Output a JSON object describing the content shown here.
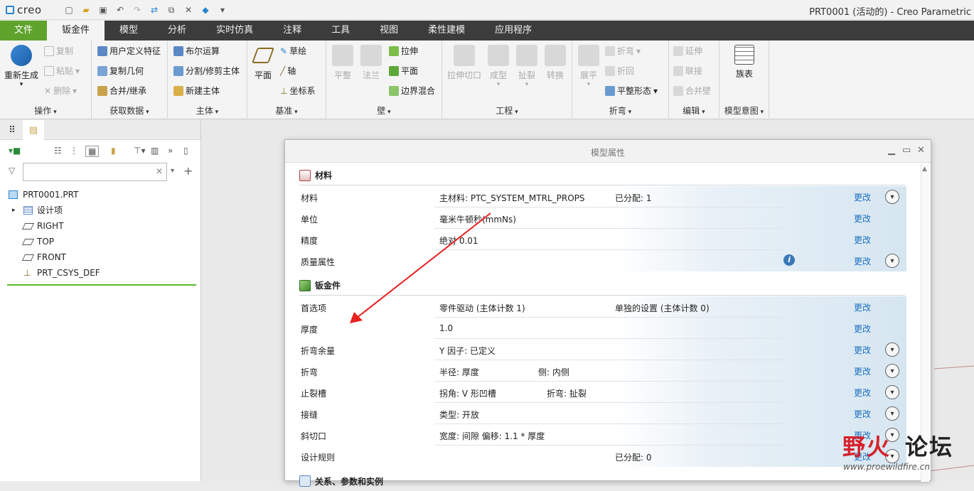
{
  "app": {
    "logo": "creo",
    "window_title": "PRT0001 (活动的) - Creo Parametric"
  },
  "quick_access": [
    "new-icon",
    "open-icon",
    "save-icon",
    "undo-icon",
    "redo-icon",
    "regenerate-icon",
    "windows-icon",
    "close-icon",
    "settings-icon",
    "customize-icon"
  ],
  "tabs": [
    "文件",
    "钣金件",
    "模型",
    "分析",
    "实时仿真",
    "注释",
    "工具",
    "视图",
    "柔性建模",
    "应用程序"
  ],
  "ribbon": {
    "ops": {
      "regen": "重新生成",
      "copy": "复制",
      "paste": "粘贴",
      "delete": "删除",
      "label": "操作"
    },
    "getdata": {
      "udf": "用户定义特征",
      "copygeom": "复制几何",
      "merge": "合并/继承",
      "label": "获取数据"
    },
    "body": {
      "boolean": "布尔运算",
      "split": "分割/修剪主体",
      "newbody": "新建主体",
      "label": "主体"
    },
    "datum": {
      "plane": "平面",
      "sketch": "草绘",
      "axis": "轴",
      "csys": "坐标系",
      "label": "基准"
    },
    "wall": {
      "flat": "平整",
      "flange": "法兰",
      "extrude": "拉伸",
      "planar": "平面",
      "blend": "边界混合",
      "label": "壁"
    },
    "eng": {
      "cut": "拉伸切口",
      "form": "成型",
      "rip": "扯裂",
      "convert": "转换",
      "label": "工程"
    },
    "bend": {
      "unbend": "展平",
      "bend": "折弯",
      "bendback": "折回",
      "flatform": "平整形态",
      "label": "折弯"
    },
    "edit": {
      "extend": "延伸",
      "join": "联接",
      "merge": "合并壁",
      "label": "编辑"
    },
    "intent": {
      "family": "族表",
      "label": "模型意图"
    }
  },
  "filter": {
    "placeholder": ""
  },
  "tree": {
    "root": "PRT0001.PRT",
    "items": [
      "设计项",
      "RIGHT",
      "TOP",
      "FRONT",
      "PRT_CSYS_DEF"
    ]
  },
  "dialog": {
    "title": "模型属性",
    "change_label": "更改",
    "sections": [
      {
        "title": "材料",
        "rows": [
          {
            "name": "材料",
            "v1": "主材料: PTC_SYSTEM_MTRL_PROPS",
            "v2": "已分配: 1",
            "expand": true
          },
          {
            "name": "单位",
            "v1": "毫米牛顿秒(mmNs)",
            "v2": "",
            "expand": false
          },
          {
            "name": "精度",
            "v1": "绝对 0.01",
            "v2": "",
            "expand": false
          },
          {
            "name": "质量属性",
            "v1": "",
            "v2": "",
            "expand": true,
            "info": "i"
          }
        ]
      },
      {
        "title": "钣金件",
        "rows": [
          {
            "name": "首选项",
            "v1": "零件驱动 (主体计数 1)",
            "v2": "单独的设置 (主体计数 0)",
            "expand": false
          },
          {
            "name": "厚度",
            "v1": "1.0",
            "v2": "",
            "expand": false
          },
          {
            "name": "折弯余量",
            "v1": "Y 因子: 已定义",
            "v2": "",
            "expand": true
          },
          {
            "name": "折弯",
            "v1": "半径: 厚度",
            "v2": "侧: 内侧",
            "expand": true
          },
          {
            "name": "止裂槽",
            "v1": "拐角: V 形凹槽",
            "v2": "折弯: 扯裂",
            "expand": true
          },
          {
            "name": "接缝",
            "v1": "类型: 开放",
            "v2": "",
            "expand": true
          },
          {
            "name": "斜切口",
            "v1": "宽度: 间隙 偏移: 1.1 * 厚度",
            "v2": "",
            "expand": true
          },
          {
            "name": "设计规则",
            "v1": "",
            "v2": "已分配: 0",
            "expand": true
          }
        ]
      },
      {
        "title": "关系、参数和实例"
      }
    ]
  },
  "watermark": {
    "part1": "野火",
    "part2": "论坛",
    "url": "www.proewildfire.cn"
  }
}
